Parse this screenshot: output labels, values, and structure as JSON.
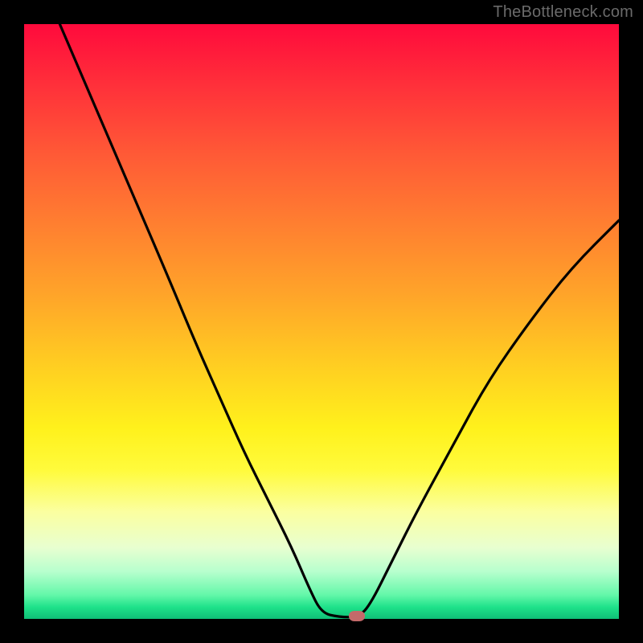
{
  "watermark": "TheBottleneck.com",
  "colors": {
    "frame": "#000000",
    "curve": "#000000",
    "marker": "#c46a6a",
    "gradient_stops": [
      "#ff0a3c",
      "#ff2f3a",
      "#ff5a36",
      "#ff8030",
      "#ffa629",
      "#ffd021",
      "#fff11c",
      "#fffb3c",
      "#fbffa0",
      "#e8ffd0",
      "#b8ffce",
      "#63f7a9",
      "#1fe28a",
      "#0fbf77"
    ]
  },
  "chart_data": {
    "type": "line",
    "title": "",
    "xlabel": "",
    "ylabel": "",
    "xlim": [
      0,
      100
    ],
    "ylim": [
      0,
      100
    ],
    "categories": [],
    "series": [
      {
        "name": "curve",
        "points": [
          {
            "x": 6,
            "y": 100
          },
          {
            "x": 12,
            "y": 86
          },
          {
            "x": 18,
            "y": 72
          },
          {
            "x": 24,
            "y": 58
          },
          {
            "x": 29,
            "y": 46
          },
          {
            "x": 33,
            "y": 37
          },
          {
            "x": 37,
            "y": 28
          },
          {
            "x": 41,
            "y": 20
          },
          {
            "x": 45,
            "y": 12
          },
          {
            "x": 48,
            "y": 5
          },
          {
            "x": 50,
            "y": 1
          },
          {
            "x": 53,
            "y": 0.3
          },
          {
            "x": 56,
            "y": 0.3
          },
          {
            "x": 58,
            "y": 2
          },
          {
            "x": 62,
            "y": 10
          },
          {
            "x": 66,
            "y": 18
          },
          {
            "x": 72,
            "y": 29
          },
          {
            "x": 78,
            "y": 40
          },
          {
            "x": 85,
            "y": 50
          },
          {
            "x": 92,
            "y": 59
          },
          {
            "x": 100,
            "y": 67
          }
        ]
      }
    ],
    "marker": {
      "x": 56,
      "y": 0.5
    }
  }
}
